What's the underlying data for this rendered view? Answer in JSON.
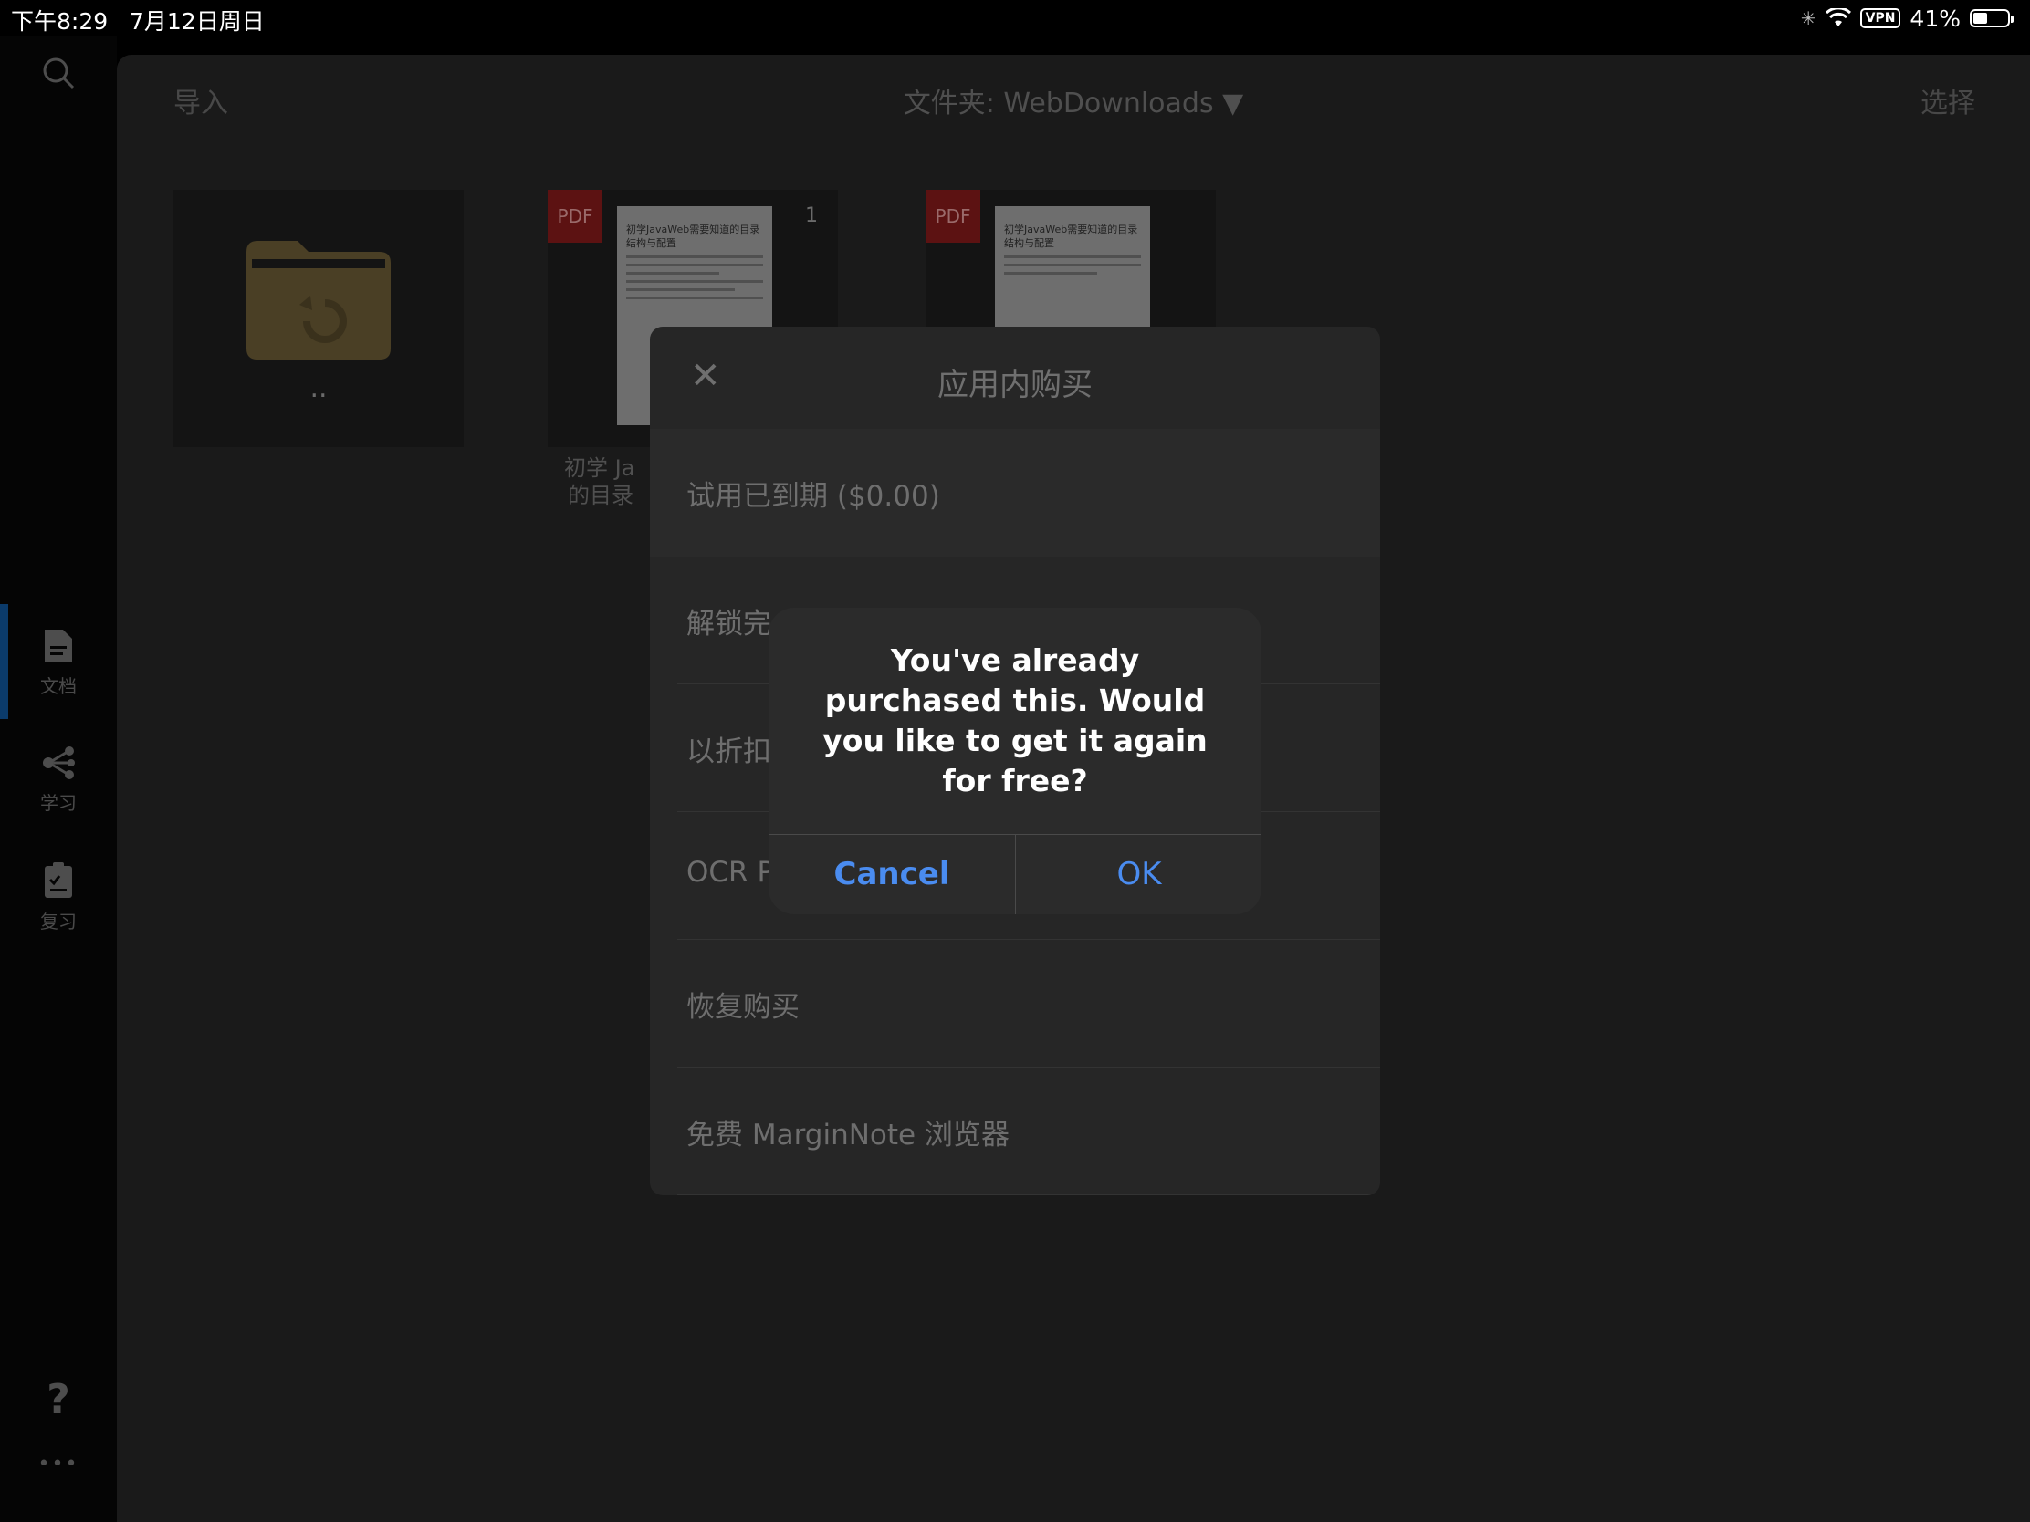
{
  "status_bar": {
    "time": "下午8:29",
    "date": "7月12日周日",
    "vpn": "VPN",
    "battery": "41%",
    "battery_level": 0.41
  },
  "sidebar": {
    "items": [
      {
        "label": "文档",
        "icon": "document-icon"
      },
      {
        "label": "学习",
        "icon": "mindmap-icon"
      },
      {
        "label": "复习",
        "icon": "review-clipboard-icon"
      }
    ],
    "help_symbol": "?",
    "more_symbol": "•••"
  },
  "topbar": {
    "import_label": "导入",
    "folder_title": "文件夹: WebDownloads ▼",
    "select_label": "选择"
  },
  "files": [
    {
      "type": "folder",
      "label": ".."
    },
    {
      "type": "pdf",
      "badge": "PDF",
      "page": "1",
      "thumb_title": "初学JavaWeb需要知道的目录结构与配置",
      "caption_line1": "初学 Ja",
      "caption_line2": "的目录"
    },
    {
      "type": "pdf",
      "badge": "PDF",
      "thumb_title": "初学JavaWeb需要知道的目录结构与配置"
    }
  ],
  "purchase_sheet": {
    "close_symbol": "✕",
    "title": "应用内购买",
    "rows": [
      "试用已到期 ($0.00)",
      "解锁完",
      "以折扣",
      "OCR P",
      "恢复购买",
      "免费 MarginNote 浏览器"
    ]
  },
  "alert": {
    "message": "You've already purchased this. Would you like to get it again for free?",
    "cancel_label": "Cancel",
    "ok_label": "OK"
  },
  "colors": {
    "accent_blue": "#4a8cf0",
    "pdf_red": "#5c1212",
    "folder_brown": "#4a3f25"
  }
}
